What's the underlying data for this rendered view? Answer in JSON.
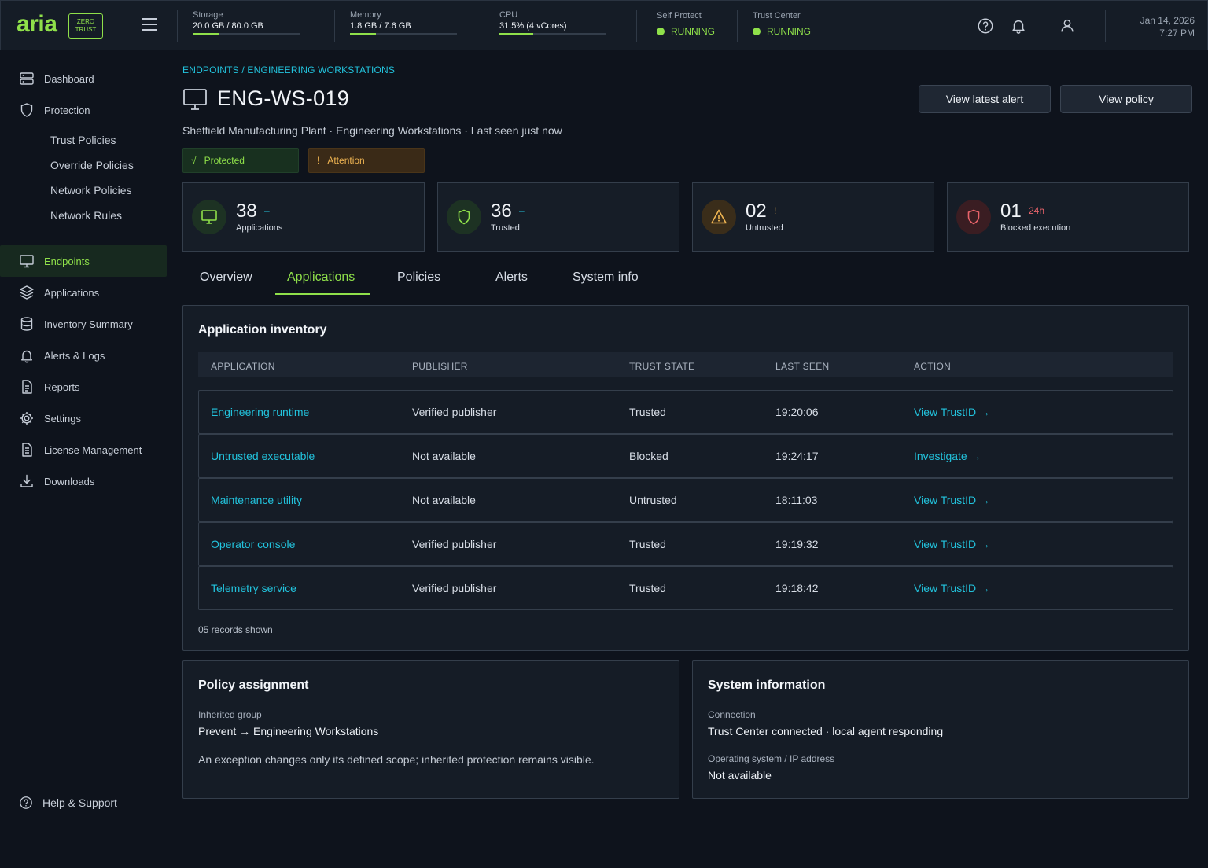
{
  "brand": {
    "name": "aria",
    "badge_line1": "ZERO",
    "badge_line2": "TRUST"
  },
  "topbar": {
    "storage": {
      "label": "Storage",
      "value": "20.0 GB / 80.0 GB",
      "fraction": 0.25
    },
    "memory": {
      "label": "Memory",
      "value": "1.8 GB / 7.6 GB",
      "fraction": 0.24
    },
    "cpu": {
      "label": "CPU",
      "value": "31.5% (4 vCores)",
      "fraction": 0.315
    },
    "self_protect": {
      "label": "Self Protect",
      "value": "RUNNING"
    },
    "trust_center": {
      "label": "Trust Center",
      "value": "RUNNING"
    },
    "date": "Jan 14, 2026",
    "time": "7:27 PM",
    "icons": [
      "help-icon",
      "bell-icon",
      "user-icon"
    ]
  },
  "sidebar": {
    "dashboard": "Dashboard",
    "protection": "Protection",
    "protection_sub": [
      "Trust Policies",
      "Override Policies",
      "Network Policies",
      "Network Rules"
    ],
    "endpoints": "Endpoints",
    "applications": "Applications",
    "inventory": "Inventory Summary",
    "alerts": "Alerts & Logs",
    "reports": "Reports",
    "settings": "Settings",
    "license": "License Management",
    "downloads": "Downloads",
    "help": "Help & Support"
  },
  "header": {
    "breadcrumb": "ENDPOINTS / ENGINEERING WORKSTATIONS",
    "title": "ENG-WS-019",
    "subtitle": "Sheffield Manufacturing Plant · Engineering Workstations · Last seen just now",
    "btn_alert": "View latest alert",
    "btn_policy": "View policy",
    "pill_protected_icon": "√",
    "pill_protected": "Protected",
    "pill_attention_icon": "!",
    "pill_attention": "Attention"
  },
  "stats": [
    {
      "value": "38",
      "mark": "–",
      "label": "Applications",
      "color": "#8fe04a"
    },
    {
      "value": "36",
      "mark": "–",
      "label": "Trusted",
      "color": "#8fe04a"
    },
    {
      "value": "02",
      "mark": "!",
      "label": "Untrusted",
      "color": "#f0b552"
    },
    {
      "value": "01",
      "mark": "24h",
      "label": "Blocked execution",
      "color": "#e8636a"
    }
  ],
  "tabs": [
    "Overview",
    "Applications",
    "Policies",
    "Alerts",
    "System info"
  ],
  "inventory": {
    "title": "Application inventory",
    "columns": [
      "APPLICATION",
      "PUBLISHER",
      "TRUST STATE",
      "LAST SEEN",
      "ACTION"
    ],
    "rows": [
      {
        "app": "Engineering runtime",
        "publisher": "Verified publisher",
        "state": "Trusted",
        "seen": "19:20:06",
        "action": "View TrustID →"
      },
      {
        "app": "Untrusted executable",
        "publisher": "Not available",
        "state": "Blocked",
        "seen": "19:24:17",
        "action": "Investigate →"
      },
      {
        "app": "Maintenance utility",
        "publisher": "Not available",
        "state": "Untrusted",
        "seen": "18:11:03",
        "action": "View TrustID →"
      },
      {
        "app": "Operator console",
        "publisher": "Verified publisher",
        "state": "Trusted",
        "seen": "19:19:32",
        "action": "View TrustID →"
      },
      {
        "app": "Telemetry service",
        "publisher": "Verified publisher",
        "state": "Trusted",
        "seen": "19:18:42",
        "action": "View TrustID →"
      }
    ],
    "records": "05 records shown"
  },
  "policy": {
    "title": "Policy assignment",
    "group_label": "Inherited group",
    "group_value": "Prevent → Engineering Workstations",
    "note": "An exception changes only its defined scope; inherited protection remains visible."
  },
  "sysinfo": {
    "title": "System information",
    "conn_label": "Connection",
    "conn_value": "Trust Center connected · local agent responding",
    "os_label": "Operating system / IP address",
    "os_value": "Not available"
  },
  "colors": {
    "accent": "#8fe04a",
    "link": "#22c3dd",
    "warning": "#f0b552",
    "danger": "#e8636a"
  }
}
